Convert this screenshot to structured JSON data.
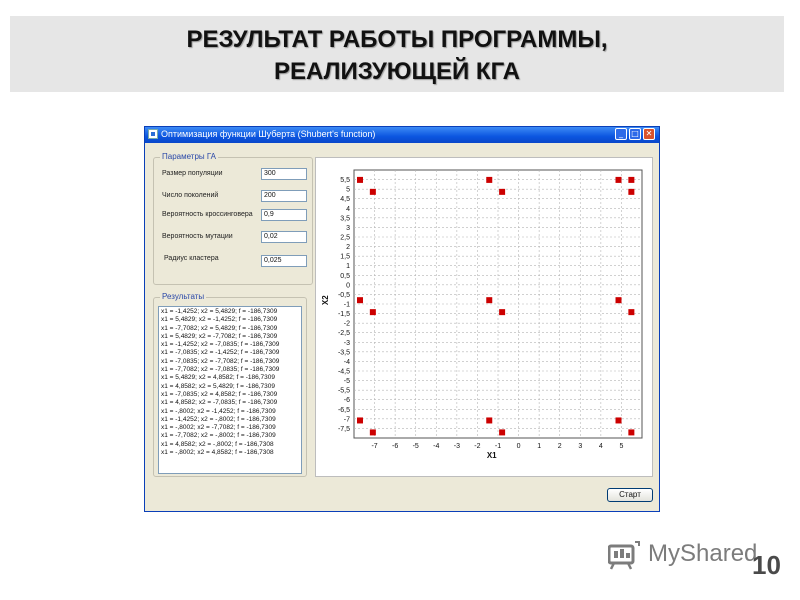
{
  "slide": {
    "title_line1": "РЕЗУЛЬТАТ РАБОТЫ ПРОГРАММЫ,",
    "title_line2": "РЕАЛИЗУЮЩЕЙ  КГА",
    "slide_number": "10",
    "brand_text": "MyShared"
  },
  "window": {
    "title": "Оптимизация функции Шуберта (Shubert's function)",
    "buttons": {
      "minimize": "_",
      "maximize": "□",
      "close": "✕"
    }
  },
  "params": {
    "group_label": "Параметры ГА",
    "fields": [
      {
        "label": "Размер популяции",
        "value": "300"
      },
      {
        "label": "Число поколений",
        "value": "200"
      },
      {
        "label": "Вероятность кроссинговера",
        "value": "0,9"
      },
      {
        "label": "Вероятность мутации",
        "value": "0,02"
      },
      {
        "label": "Радиус кластера",
        "value": "0,025"
      }
    ]
  },
  "results": {
    "group_label": "Результаты",
    "lines": [
      "x1 = -1,4252;  x2 = 5,4829;  f = -186,7309",
      "x1 = 5,4829;  x2 = -1,4252;  f = -186,7309",
      "x1 = -7,7082;  x2 = 5,4829;  f = -186,7309",
      "x1 = 5,4829;  x2 = -7,7082;  f = -186,7309",
      "x1 = -1,4252;  x2 = -7,0835;  f = -186,7309",
      "x1 = -7,0835;  x2 = -1,4252;  f = -186,7309",
      "x1 = -7,0835;  x2 = -7,7082;  f = -186,7309",
      "x1 = -7,7082;  x2 = -7,0835;  f = -186,7309",
      "x1 = 5,4829;  x2 = 4,8582;  f = -186,7309",
      "x1 = 4,8582;  x2 = 5,4829;  f = -186,7309",
      "x1 = -7,0835;  x2 = 4,8582;  f = -186,7309",
      "x1 = 4,8582;  x2 = -7,0835;  f = -186,7309",
      "x1 = -,8002;  x2 = -1,4252;  f = -186,7309",
      "x1 = -1,4252;  x2 = -,8002;  f = -186,7309",
      "x1 = -,8002;  x2 = -7,7082;  f = -186,7309",
      "x1 = -7,7082;  x2 = -,8002;  f = -186,7309",
      "x1 = 4,8582;  x2 = -,8002;  f = -186,7308",
      "x1 = -,8002;  x2 = 4,8582;  f = -186,7308"
    ]
  },
  "start_button": "Старт",
  "chart_data": {
    "type": "scatter",
    "xlabel": "X1",
    "ylabel": "X2",
    "xlim": [
      -8,
      6
    ],
    "ylim": [
      -8,
      6
    ],
    "grid": true,
    "marker_color": "#cc0000",
    "x_ticks": [
      "-7",
      "-6",
      "-5",
      "-4",
      "-3",
      "-2",
      "-1",
      "0",
      "1",
      "2",
      "3",
      "4",
      "5"
    ],
    "y_ticks": [
      "5,5",
      "5",
      "4,5",
      "4",
      "3,5",
      "3",
      "2,5",
      "2",
      "1,5",
      "1",
      "0,5",
      "0",
      "-0,5",
      "-1",
      "-1,5",
      "-2",
      "-2,5",
      "-3",
      "-3,5",
      "-4",
      "-4,5",
      "-5",
      "-5,5",
      "-6",
      "-6,5",
      "-7",
      "-7,5"
    ],
    "points": [
      [
        -7.7082,
        5.4829
      ],
      [
        -1.4252,
        5.4829
      ],
      [
        5.4829,
        5.4829
      ],
      [
        -7.0835,
        4.8582
      ],
      [
        -0.8002,
        4.8582
      ],
      [
        4.8582,
        5.4829
      ],
      [
        5.4829,
        4.8582
      ],
      [
        -7.7082,
        -0.8002
      ],
      [
        -1.4252,
        -0.8002
      ],
      [
        4.8582,
        -0.8002
      ],
      [
        -7.0835,
        -1.4252
      ],
      [
        -0.8002,
        -1.4252
      ],
      [
        5.4829,
        -1.4252
      ],
      [
        -7.7082,
        -7.0835
      ],
      [
        -1.4252,
        -7.0835
      ],
      [
        4.8582,
        -7.0835
      ],
      [
        -7.0835,
        -7.7082
      ],
      [
        -0.8002,
        -7.7082
      ],
      [
        5.4829,
        -7.7082
      ]
    ]
  }
}
